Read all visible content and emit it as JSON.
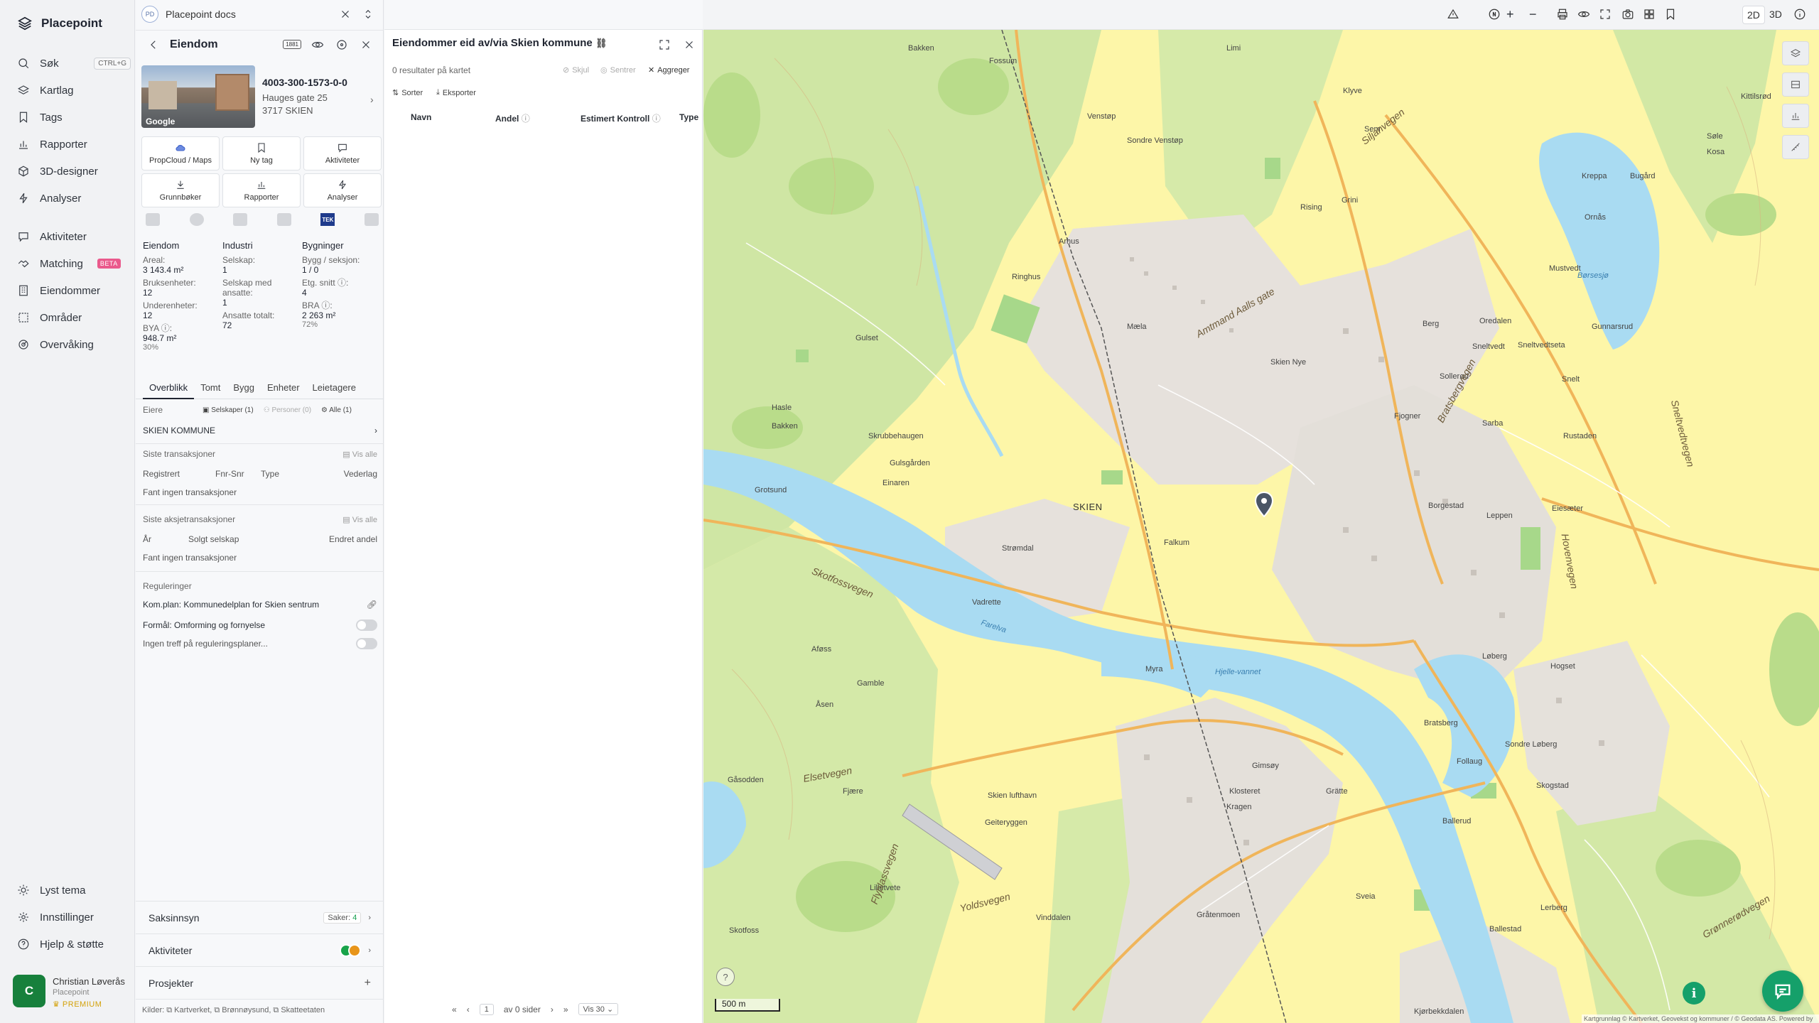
{
  "app": {
    "name": "Placepoint"
  },
  "nav": {
    "items": [
      {
        "label": "Søk",
        "shortcut": "CTRL+G",
        "icon": "search-icon"
      },
      {
        "label": "Kartlag",
        "icon": "layers-icon"
      },
      {
        "label": "Tags",
        "icon": "bookmark-icon"
      },
      {
        "label": "Rapporter",
        "icon": "chart-icon"
      },
      {
        "label": "3D-designer",
        "icon": "cube-icon"
      },
      {
        "label": "Analyser",
        "icon": "bolt-icon"
      },
      {
        "label": "Aktiviteter",
        "icon": "chat-icon"
      },
      {
        "label": "Matching",
        "badge": "BETA",
        "icon": "handshake-icon"
      },
      {
        "label": "Eiendommer",
        "icon": "building-icon"
      },
      {
        "label": "Områder",
        "icon": "area-icon"
      },
      {
        "label": "Overvåking",
        "icon": "radar-icon"
      }
    ],
    "bottom": [
      {
        "label": "Lyst tema",
        "icon": "sun-icon"
      },
      {
        "label": "Innstillinger",
        "icon": "gear-icon"
      },
      {
        "label": "Hjelp & støtte",
        "icon": "help-icon"
      }
    ],
    "user": {
      "initial": "C",
      "name": "Christian Løverås",
      "org": "Placepoint",
      "plan": "PREMIUM"
    }
  },
  "docs": {
    "badge": "PD",
    "title": "Placepoint docs"
  },
  "property": {
    "header": "Eiendom",
    "header_badge": "1881",
    "id": "4003-300-1573-0-0",
    "street": "Hauges gate 25",
    "postal": "3717 SKIEN",
    "photo_label": "Google",
    "tiles": [
      {
        "label": "PropCloud / Maps",
        "icon": "cloud-icon"
      },
      {
        "label": "Ny tag",
        "icon": "bookmark-icon"
      },
      {
        "label": "Aktiviteter",
        "icon": "chat-icon"
      },
      {
        "label": "Grunnbøker",
        "icon": "download-icon"
      },
      {
        "label": "Rapporter",
        "icon": "chart-icon"
      },
      {
        "label": "Analyser",
        "icon": "bolt-icon"
      }
    ],
    "tek_label": "TEK",
    "stats": {
      "eiendom": {
        "title": "Eiendom",
        "areal_label": "Areal:",
        "areal": "3 143.4 m²",
        "bruks_label": "Bruksenheter:",
        "bruks": "12",
        "under_label": "Underenheter:",
        "under": "12",
        "bya_label": "BYA ⓘ:",
        "bya": "948.7 m²",
        "bya_pct": "30%"
      },
      "industri": {
        "title": "Industri",
        "selskap_label": "Selskap:",
        "selskap": "1",
        "med_ans_label": "Selskap med ansatte:",
        "med_ans": "1",
        "ans_tot_label": "Ansatte totalt:",
        "ans_tot": "72"
      },
      "bygninger": {
        "title": "Bygninger",
        "bygg_label": "Bygg / seksjon:",
        "bygg": "1 / 0",
        "etg_label": "Etg. snitt ⓘ:",
        "etg": "4",
        "bra_label": "BRA ⓘ:",
        "bra": "2 263 m²",
        "bra_pct": "72%"
      }
    },
    "subtabs": [
      "Overblikk",
      "Tomt",
      "Bygg",
      "Enheter",
      "Leietagere"
    ],
    "owners": {
      "label": "Eiere",
      "f_companies": "Selskaper (1)",
      "f_persons": "Personer (0)",
      "f_all": "Alle (1)",
      "owner": "SKIEN KOMMUNE"
    },
    "transactions": {
      "title": "Siste transaksjoner",
      "view_all": "Vis alle",
      "cols": [
        "Registrert",
        "Fnr-Snr",
        "Type",
        "Vederlag"
      ],
      "empty": "Fant ingen transaksjoner"
    },
    "share_tx": {
      "title": "Siste aksjetransaksjoner",
      "view_all": "Vis alle",
      "cols": [
        "År",
        "Solgt selskap",
        "Endret andel"
      ],
      "empty": "Fant ingen transaksjoner"
    },
    "regulations": {
      "title": "Reguleringer",
      "plan": "Kom.plan: Kommunedelplan for Skien sentrum",
      "purpose": "Formål: Omforming og fornyelse",
      "none": "Ingen treff på reguleringsplaner..."
    },
    "bottom": [
      {
        "label": "Saksinnsyn",
        "extra": "Saker:",
        "count": "4"
      },
      {
        "label": "Aktiviteter"
      },
      {
        "label": "Prosjekter"
      }
    ],
    "sources": "Kilder: ⧉ Kartverket, ⧉ Brønnøysund, ⧉ Skatteetaten"
  },
  "results": {
    "title": "Eiendommer eid av/via Skien kommune",
    "count": "0 resultater på kartet",
    "actions": {
      "hide": "Skjul",
      "center": "Sentrer",
      "aggregate": "Aggreger",
      "sort": "Sorter",
      "export": "Eksporter"
    },
    "columns": [
      "Navn",
      "Andel",
      "Estimert Kontroll",
      "Type"
    ],
    "pager": {
      "page": "1",
      "of": "av 0 sider",
      "show": "Vis 30"
    }
  },
  "map": {
    "modes": [
      "2D",
      "3D"
    ],
    "places": [
      "Bakken",
      "Fossum",
      "Venstøp",
      "Sondre Venstøp",
      "Limi",
      "Klyve",
      "Kittilsrød",
      "Søle",
      "Kosa",
      "Kreppa",
      "Bugård",
      "Ringhus",
      "Arhus",
      "Rising",
      "Grini",
      "Ornås",
      "Gulset",
      "Mæla",
      "Skien Nye",
      "Sem",
      "Hasle",
      "Bakken",
      "Skrubbehaugen",
      "Gulsgården",
      "Einaren",
      "Gunnarsrud",
      "Grotsund",
      "SKIEN",
      "Falkum",
      "Strømdal",
      "Vadrette",
      "Myra",
      "Aføss",
      "Åsen",
      "Gamble",
      "Gåsodden",
      "Fjære",
      "Skien lufthavn",
      "Geiteryggen",
      "Gimsøy",
      "Klosteret",
      "Kragen",
      "Grätte",
      "Lilletvete",
      "Vinddalen",
      "Gråtenmoen",
      "Skotfoss",
      "Kjørbekkdalen",
      "Sveia",
      "Bratsberg",
      "Follaug",
      "Løberg",
      "Hogset",
      "Leppen",
      "Eiesæter",
      "Rustaden",
      "Sarba",
      "Sondre Løberg",
      "Skogstad",
      "Ballestad",
      "Lerberg",
      "Oredalen",
      "Berg",
      "Mustvedt",
      "Sneltvedt",
      "Sollerød",
      "Sneltvedtseta",
      "Snelt",
      "Fjogner",
      "Borgestad",
      "Ballerud"
    ],
    "roads": [
      "Skotfossvegen",
      "Elsetvegen",
      "Bratsbergvegen",
      "Siljanvegen",
      "Amtmand Aalls gate",
      "Yoldsvegen",
      "Flyplassvegen",
      "Sneltvedtvegen",
      "Hovenvegen",
      "Grønnerødvegen"
    ],
    "water": [
      "Børsesjø",
      "Hjelle-vannet",
      "Farelva"
    ],
    "scale": "500 m",
    "attribution": "Kartgrunnlag © Kartverket, Geovekst og kommuner / © Geodata AS. Powered by Esri"
  }
}
